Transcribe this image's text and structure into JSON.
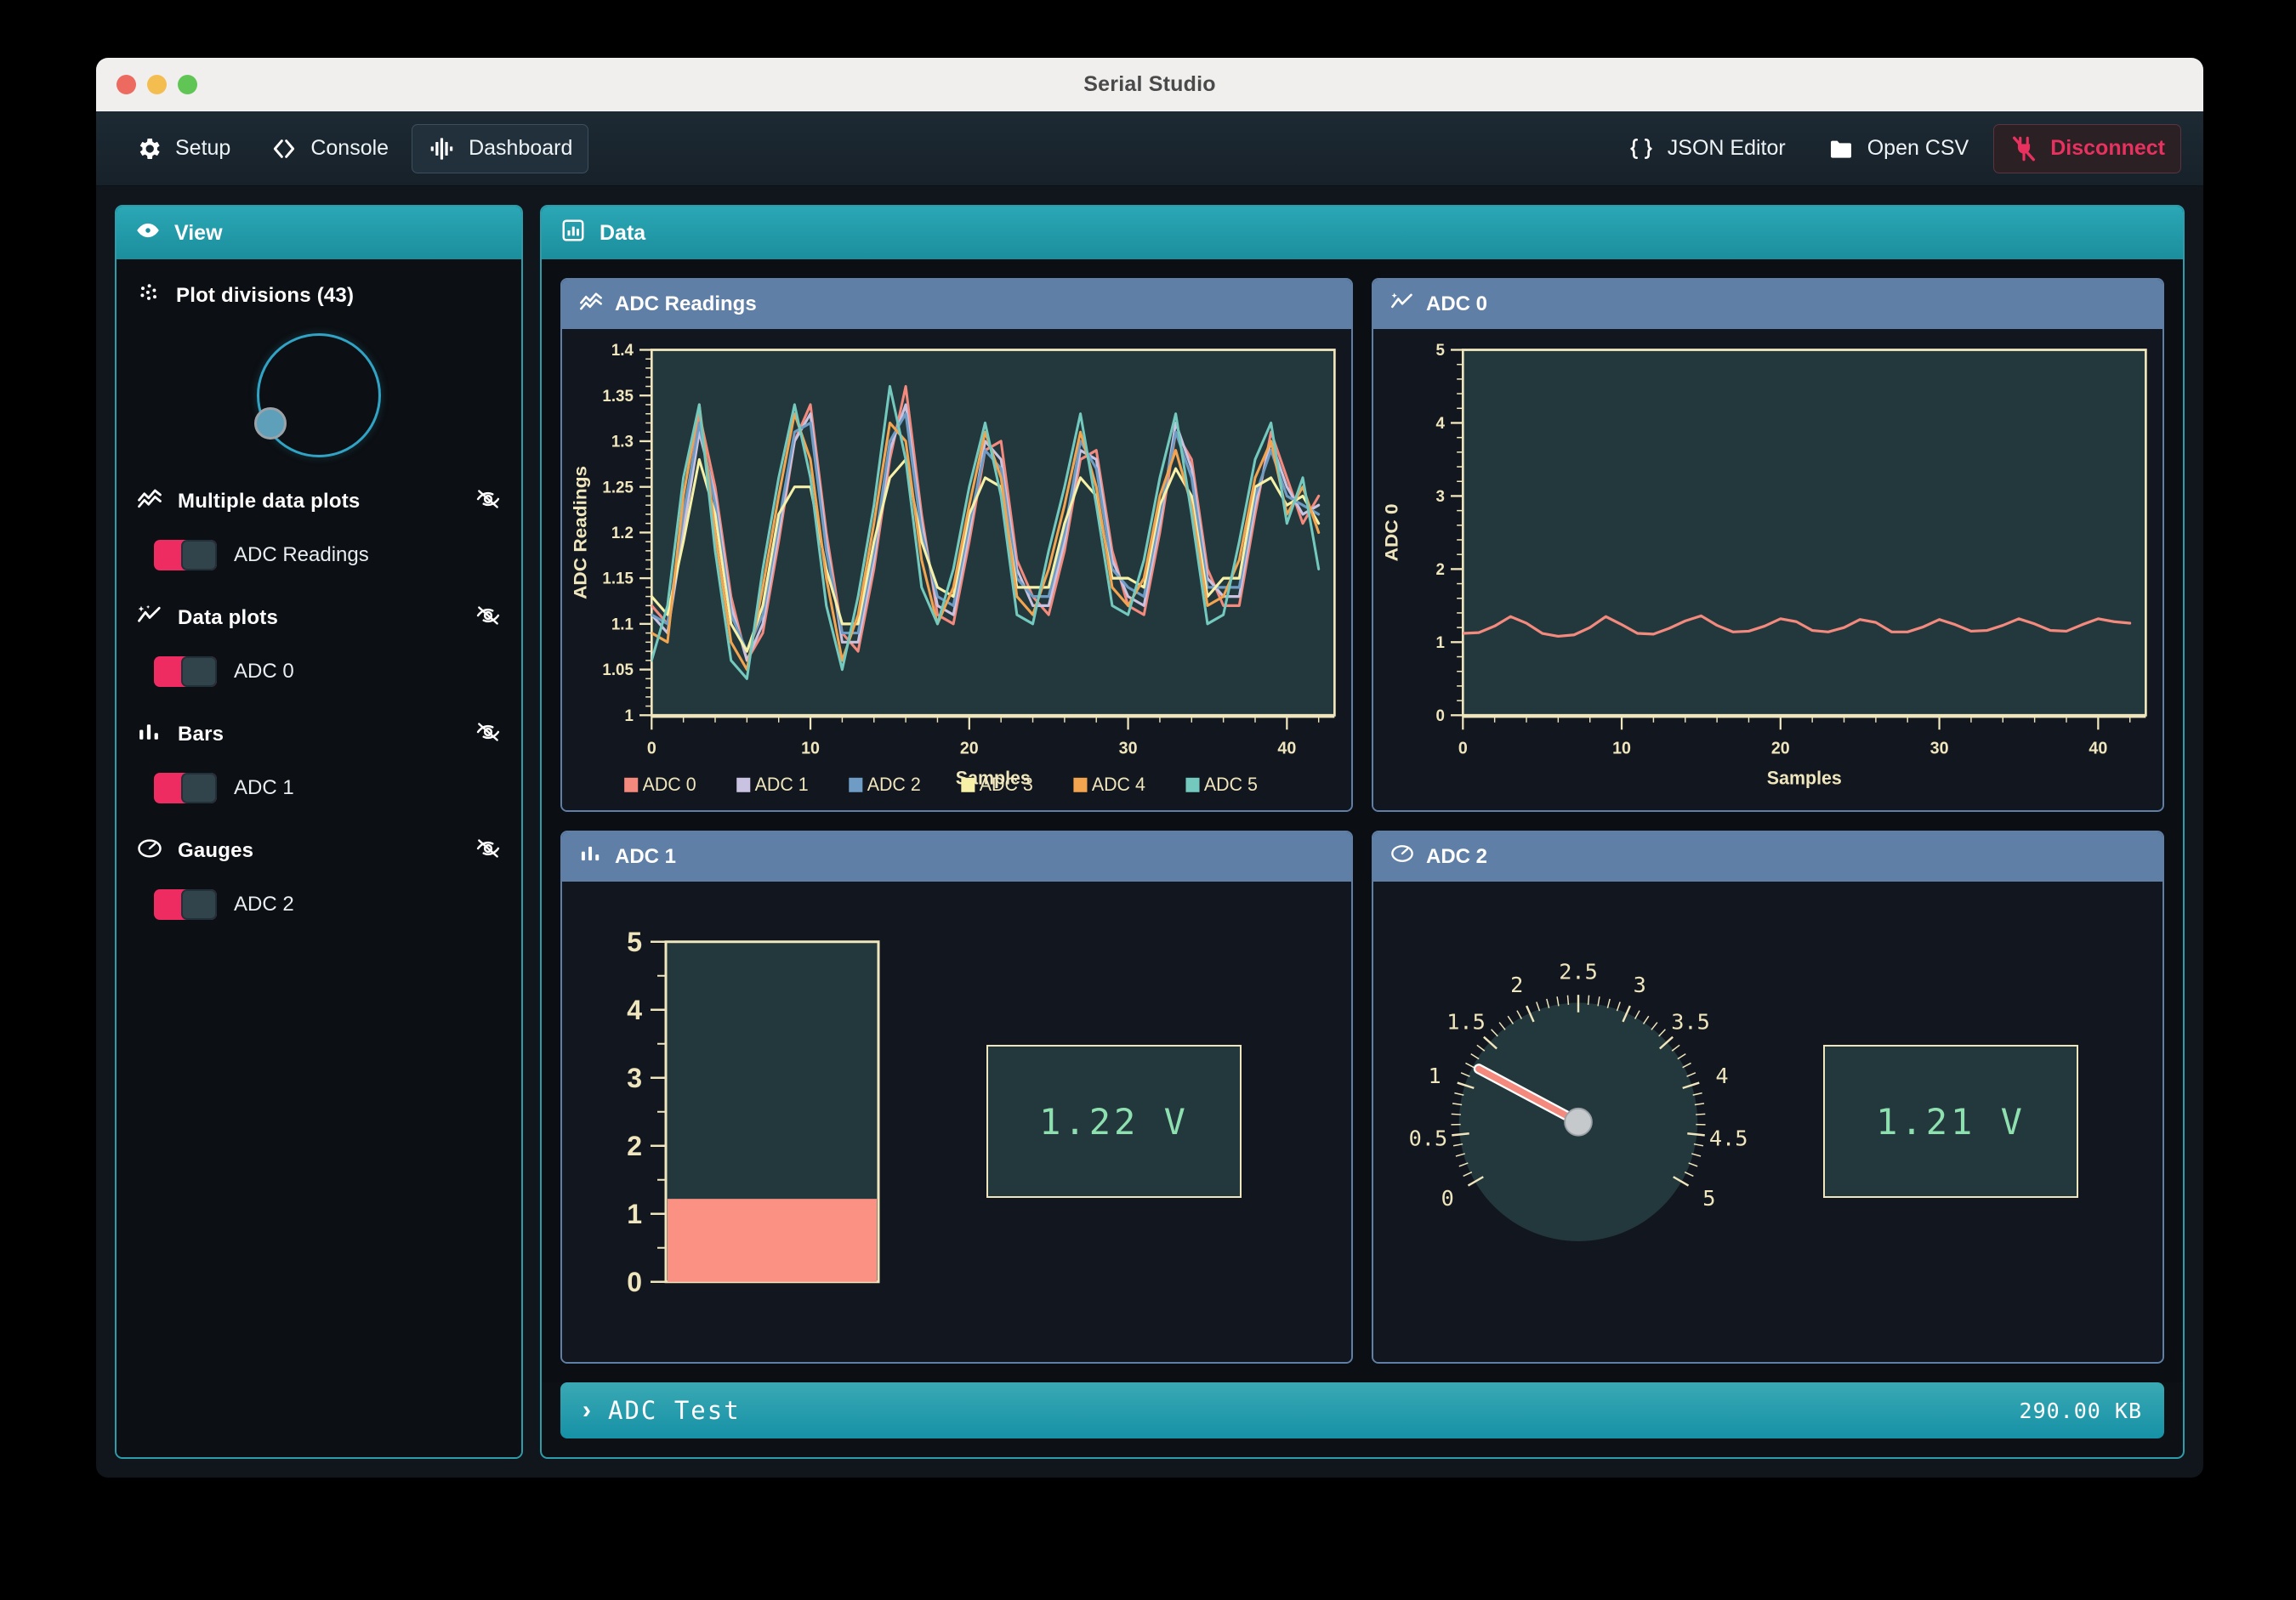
{
  "window": {
    "title": "Serial Studio"
  },
  "toolbar": {
    "setup_label": "Setup",
    "console_label": "Console",
    "dashboard_label": "Dashboard",
    "json_editor_label": "JSON Editor",
    "open_csv_label": "Open CSV",
    "disconnect_label": "Disconnect",
    "accent_danger": "#e8315f",
    "active_tab": "Dashboard"
  },
  "sidebar": {
    "header": "View",
    "plot_divisions_label": "Plot divisions (43)",
    "plot_divisions_value": 43,
    "sections": [
      {
        "title": "Multiple data plots",
        "hidden_icon": "eye-off-icon",
        "items": [
          {
            "label": "ADC Readings",
            "enabled": true
          }
        ]
      },
      {
        "title": "Data plots",
        "hidden_icon": "eye-off-icon",
        "items": [
          {
            "label": "ADC 0",
            "enabled": true
          }
        ]
      },
      {
        "title": "Bars",
        "hidden_icon": "eye-off-icon",
        "items": [
          {
            "label": "ADC 1",
            "enabled": true
          }
        ]
      },
      {
        "title": "Gauges",
        "hidden_icon": "eye-off-icon",
        "items": [
          {
            "label": "ADC 2",
            "enabled": true
          }
        ]
      }
    ]
  },
  "data_panel": {
    "header": "Data",
    "widgets": [
      {
        "title": "ADC Readings",
        "icon": "multi-line-chart-icon"
      },
      {
        "title": "ADC 0",
        "icon": "sparkline-icon"
      },
      {
        "title": "ADC 1",
        "icon": "bar-chart-icon"
      },
      {
        "title": "ADC 2",
        "icon": "gauge-icon"
      }
    ]
  },
  "status_bar": {
    "title": "ADC Test",
    "size": "290.00 KB",
    "chevron": "›"
  },
  "readouts": {
    "adc1_value": "1.22 V",
    "adc2_value": "1.21 V"
  },
  "chart_data": [
    {
      "id": "adc-readings",
      "type": "line",
      "title": "ADC Readings",
      "xlabel": "Samples",
      "ylabel": "ADC Readings",
      "xlim": [
        0,
        43
      ],
      "ylim": [
        1,
        1.4
      ],
      "xticks": [
        0,
        10,
        20,
        30,
        40
      ],
      "yticks": [
        1,
        1.05,
        1.1,
        1.15,
        1.2,
        1.25,
        1.3,
        1.35,
        1.4
      ],
      "grid": false,
      "legend_position": "bottom",
      "x": [
        0,
        1,
        2,
        3,
        4,
        5,
        6,
        7,
        8,
        9,
        10,
        11,
        12,
        13,
        14,
        15,
        16,
        17,
        18,
        19,
        20,
        21,
        22,
        23,
        24,
        25,
        26,
        27,
        28,
        29,
        30,
        31,
        32,
        33,
        34,
        35,
        36,
        37,
        38,
        39,
        40,
        41,
        42
      ],
      "series": [
        {
          "name": "ADC 0",
          "color": "#f4897e",
          "values": [
            1.12,
            1.1,
            1.21,
            1.33,
            1.25,
            1.13,
            1.06,
            1.09,
            1.19,
            1.3,
            1.34,
            1.2,
            1.09,
            1.07,
            1.16,
            1.28,
            1.36,
            1.22,
            1.11,
            1.1,
            1.19,
            1.29,
            1.3,
            1.17,
            1.13,
            1.11,
            1.18,
            1.28,
            1.29,
            1.18,
            1.12,
            1.11,
            1.2,
            1.31,
            1.28,
            1.16,
            1.12,
            1.12,
            1.22,
            1.31,
            1.26,
            1.21,
            1.24
          ]
        },
        {
          "name": "ADC 1",
          "color": "#c9c2e0",
          "values": [
            1.11,
            1.09,
            1.2,
            1.31,
            1.24,
            1.12,
            1.06,
            1.1,
            1.2,
            1.3,
            1.33,
            1.19,
            1.08,
            1.08,
            1.17,
            1.29,
            1.34,
            1.21,
            1.12,
            1.11,
            1.2,
            1.3,
            1.28,
            1.16,
            1.12,
            1.12,
            1.19,
            1.29,
            1.28,
            1.17,
            1.13,
            1.12,
            1.21,
            1.32,
            1.27,
            1.15,
            1.13,
            1.13,
            1.23,
            1.3,
            1.25,
            1.22,
            1.23
          ]
        },
        {
          "name": "ADC 2",
          "color": "#6f9cc4",
          "values": [
            1.11,
            1.1,
            1.22,
            1.32,
            1.23,
            1.11,
            1.07,
            1.11,
            1.21,
            1.31,
            1.32,
            1.18,
            1.09,
            1.09,
            1.18,
            1.3,
            1.33,
            1.2,
            1.13,
            1.12,
            1.21,
            1.29,
            1.27,
            1.15,
            1.13,
            1.13,
            1.2,
            1.3,
            1.27,
            1.16,
            1.14,
            1.13,
            1.22,
            1.31,
            1.26,
            1.14,
            1.14,
            1.14,
            1.24,
            1.29,
            1.24,
            1.23,
            1.22
          ]
        },
        {
          "name": "ADC 3",
          "color": "#f7f1a8",
          "values": [
            1.13,
            1.11,
            1.19,
            1.28,
            1.22,
            1.1,
            1.07,
            1.12,
            1.22,
            1.25,
            1.25,
            1.16,
            1.1,
            1.1,
            1.19,
            1.26,
            1.28,
            1.19,
            1.14,
            1.13,
            1.22,
            1.26,
            1.25,
            1.14,
            1.14,
            1.14,
            1.21,
            1.26,
            1.24,
            1.15,
            1.15,
            1.14,
            1.23,
            1.27,
            1.24,
            1.13,
            1.15,
            1.15,
            1.25,
            1.26,
            1.23,
            1.24,
            1.21
          ]
        },
        {
          "name": "ADC 4",
          "color": "#f2a44e",
          "values": [
            1.09,
            1.08,
            1.24,
            1.34,
            1.2,
            1.08,
            1.05,
            1.14,
            1.24,
            1.33,
            1.28,
            1.15,
            1.06,
            1.11,
            1.21,
            1.32,
            1.3,
            1.17,
            1.1,
            1.14,
            1.23,
            1.31,
            1.26,
            1.13,
            1.11,
            1.16,
            1.23,
            1.31,
            1.25,
            1.14,
            1.12,
            1.15,
            1.24,
            1.29,
            1.23,
            1.12,
            1.13,
            1.17,
            1.26,
            1.3,
            1.22,
            1.25,
            1.2
          ]
        },
        {
          "name": "ADC 5",
          "color": "#74c9bf",
          "values": [
            1.06,
            1.12,
            1.26,
            1.34,
            1.18,
            1.06,
            1.04,
            1.16,
            1.26,
            1.34,
            1.26,
            1.12,
            1.05,
            1.13,
            1.23,
            1.36,
            1.28,
            1.14,
            1.1,
            1.16,
            1.25,
            1.32,
            1.24,
            1.11,
            1.1,
            1.18,
            1.25,
            1.33,
            1.23,
            1.12,
            1.11,
            1.17,
            1.26,
            1.33,
            1.22,
            1.1,
            1.11,
            1.19,
            1.28,
            1.32,
            1.21,
            1.26,
            1.16
          ]
        }
      ]
    },
    {
      "id": "adc-0",
      "type": "line",
      "title": "ADC 0",
      "xlabel": "Samples",
      "ylabel": "ADC 0",
      "xlim": [
        0,
        43
      ],
      "ylim": [
        0,
        5
      ],
      "xticks": [
        0,
        10,
        20,
        30,
        40
      ],
      "yticks": [
        0,
        1,
        2,
        3,
        4,
        5
      ],
      "grid": false,
      "series": [
        {
          "name": "ADC 0",
          "color": "#f4897e",
          "values": [
            1.12,
            1.13,
            1.22,
            1.35,
            1.26,
            1.12,
            1.08,
            1.1,
            1.2,
            1.35,
            1.24,
            1.12,
            1.11,
            1.19,
            1.29,
            1.36,
            1.23,
            1.14,
            1.15,
            1.22,
            1.32,
            1.28,
            1.16,
            1.14,
            1.2,
            1.31,
            1.27,
            1.14,
            1.14,
            1.21,
            1.31,
            1.24,
            1.15,
            1.16,
            1.23,
            1.32,
            1.25,
            1.16,
            1.15,
            1.24,
            1.32,
            1.28,
            1.26
          ]
        }
      ]
    },
    {
      "id": "adc-1",
      "type": "bar",
      "title": "ADC 1",
      "categories": [
        "ADC 1"
      ],
      "values": [
        1.22
      ],
      "ylim": [
        0,
        5
      ],
      "yticks": [
        0,
        1,
        2,
        3,
        4,
        5
      ],
      "bar_color": "#fb9182",
      "readout": "1.22 V"
    },
    {
      "id": "adc-2",
      "type": "gauge",
      "title": "ADC 2",
      "value": 1.21,
      "min": 0,
      "max": 5,
      "tick_labels": [
        "0",
        "0.5",
        "1",
        "1.5",
        "2",
        "2.5",
        "3",
        "3.5",
        "4",
        "4.5",
        "5"
      ],
      "tick_values": [
        0,
        0.5,
        1,
        1.5,
        2,
        2.5,
        3,
        3.5,
        4,
        4.5,
        5
      ],
      "needle_color": "#f4897e",
      "readout": "1.21 V"
    }
  ],
  "colors": {
    "teal": "#2ba7b5",
    "panel_header": "#5f7fa6",
    "plot_bg": "#23383c",
    "axis": "#f0e6bd",
    "toggle_on": "#ef2c62",
    "readout_green": "#8fe0b0"
  }
}
